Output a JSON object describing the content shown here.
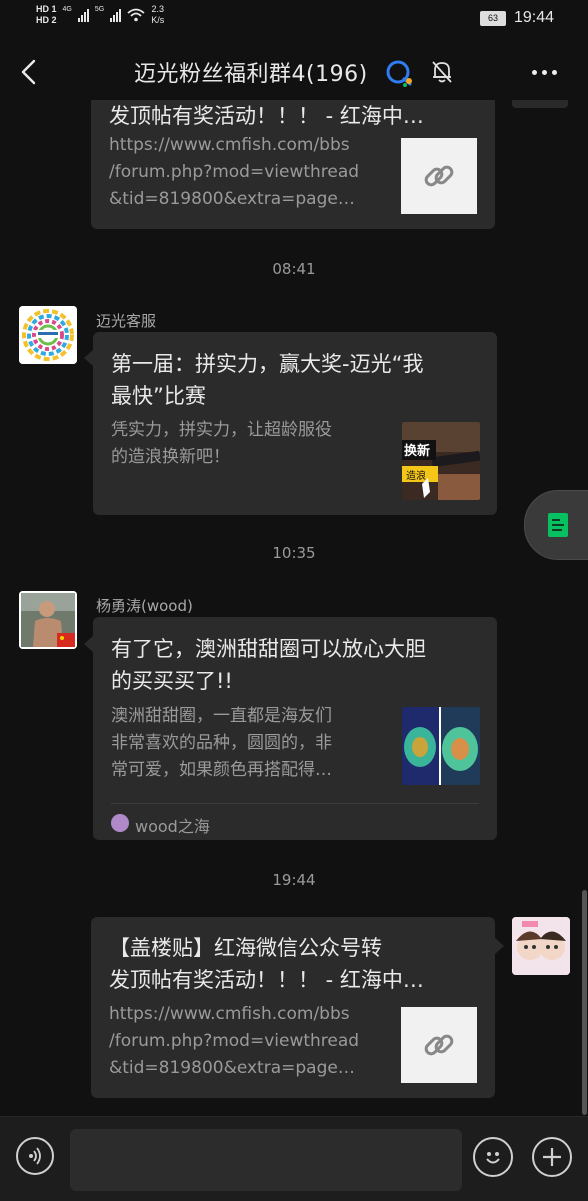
{
  "status": {
    "hd1": "HD 1",
    "hd2": "HD 2",
    "net1": "4G",
    "net2": "5G",
    "speed_value": "2.3",
    "speed_unit": "K/s",
    "battery": "63",
    "time": "19:44"
  },
  "header": {
    "title": "迈光粉丝福利群4(196)"
  },
  "messages": {
    "top_card": {
      "title_partial": "发顶帖有奖活动！！！ - 红海中…",
      "desc": [
        "https://www.cmfish.com/bbs",
        "/forum.php?mod=viewthread",
        "&tid=819800&extra=page…"
      ]
    },
    "time1": "08:41",
    "msg1": {
      "sender": "迈光客服",
      "title": [
        "第一届：拼实力，赢大奖-迈光“我",
        "最快”比赛"
      ],
      "desc": [
        "凭实力，拼实力，让超龄服役",
        "的造浪换新吧！"
      ]
    },
    "time2": "10:35",
    "msg2": {
      "sender": "杨勇涛(wood)",
      "title": [
        "有了它，澳洲甜甜圈可以放心大胆",
        "的买买买了!!"
      ],
      "desc": [
        "澳洲甜甜圈，一直都是海友们",
        "非常喜欢的品种，圆圆的，非",
        "常可爱，如果颜色再搭配得…"
      ],
      "source": "wood之海"
    },
    "time3": "19:44",
    "msg3": {
      "title": [
        "【盖楼贴】红海微信公众号转",
        "发顶帖有奖活动！！！ - 红海中…"
      ],
      "desc": [
        "https://www.cmfish.com/bbs",
        "/forum.php?mod=viewthread",
        "&tid=819800&extra=page…"
      ]
    }
  },
  "input": {
    "placeholder": ""
  },
  "colors": {
    "background": "#111111",
    "bubble": "#2b2b2b",
    "float_icon": "#07c160"
  }
}
